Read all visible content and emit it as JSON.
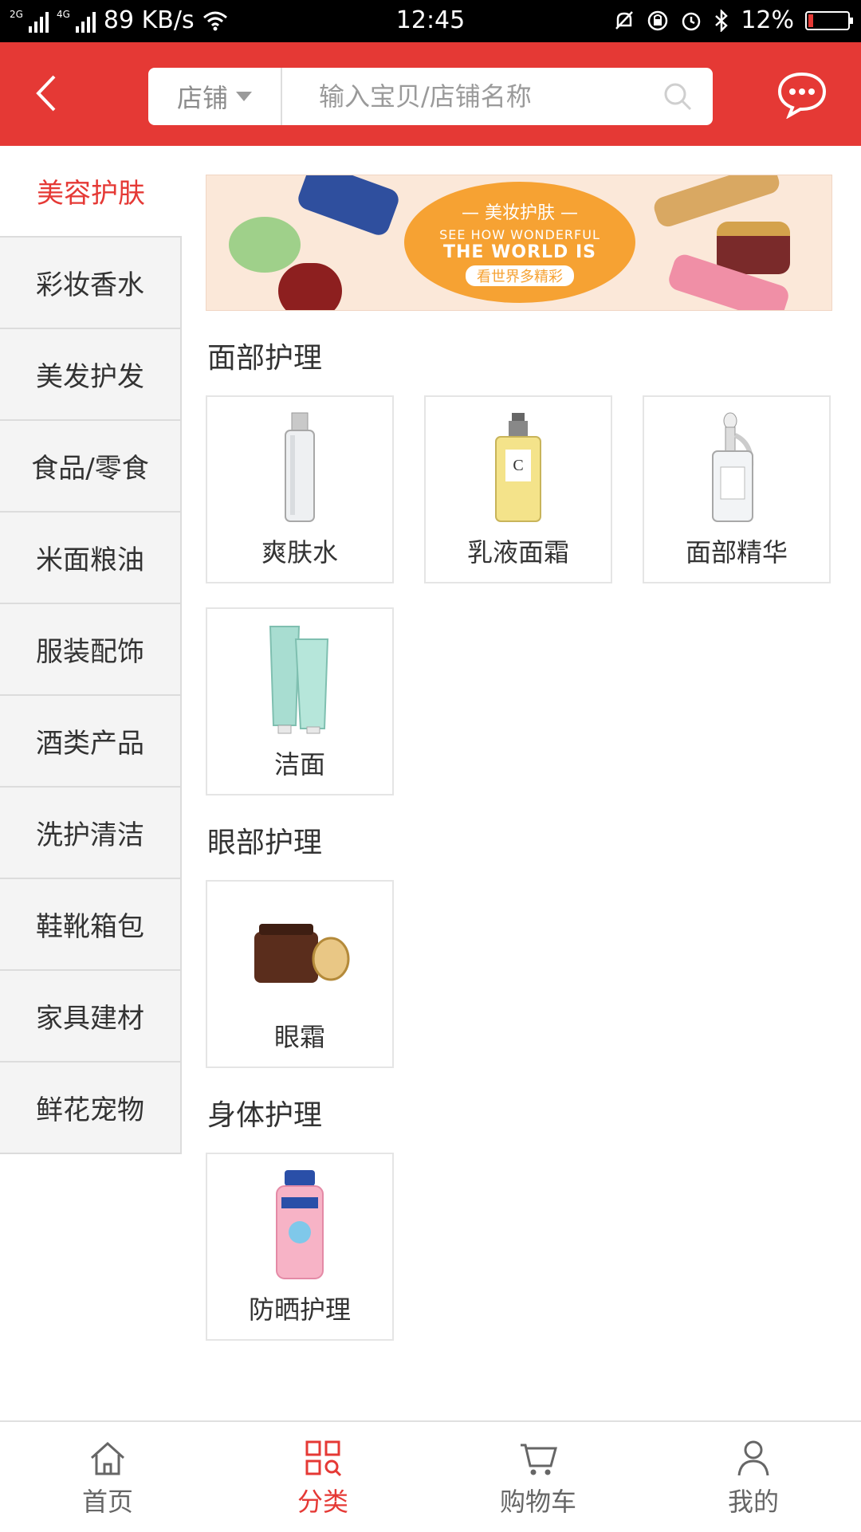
{
  "status_bar": {
    "network_2g": "2G",
    "network_4g": "4G",
    "speed": "89 KB/s",
    "time": "12:45",
    "battery": "12%",
    "battery_level": 0.12
  },
  "header": {
    "search_scope": "店铺",
    "search_placeholder": "输入宝贝/店铺名称"
  },
  "sidebar": {
    "items": [
      {
        "label": "美容护肤",
        "active": true
      },
      {
        "label": "彩妆香水"
      },
      {
        "label": "美发护发"
      },
      {
        "label": "食品/零食"
      },
      {
        "label": "米面粮油"
      },
      {
        "label": "服装配饰"
      },
      {
        "label": "酒类产品"
      },
      {
        "label": "洗护清洁"
      },
      {
        "label": "鞋靴箱包"
      },
      {
        "label": "家具建材"
      },
      {
        "label": "鲜花宠物"
      }
    ]
  },
  "banner": {
    "line1": "— 美妆护肤 —",
    "line2": "SEE HOW WONDERFUL",
    "line3": "THE WORLD IS",
    "line4": "看世界多精彩"
  },
  "sections": [
    {
      "title": "面部护理",
      "items": [
        {
          "name": "爽肤水",
          "icon": "toner-bottle-icon"
        },
        {
          "name": "乳液面霜",
          "icon": "lotion-bottle-icon"
        },
        {
          "name": "面部精华",
          "icon": "serum-dropper-icon"
        },
        {
          "name": "洁面",
          "icon": "cleanser-tubes-icon"
        }
      ]
    },
    {
      "title": "眼部护理",
      "items": [
        {
          "name": "眼霜",
          "icon": "eye-cream-jar-icon"
        }
      ]
    },
    {
      "title": "身体护理",
      "items": [
        {
          "name": "防晒护理",
          "icon": "sunscreen-bottle-icon"
        }
      ]
    }
  ],
  "tabbar": {
    "items": [
      {
        "label": "首页",
        "icon": "home-icon"
      },
      {
        "label": "分类",
        "icon": "category-icon",
        "active": true
      },
      {
        "label": "购物车",
        "icon": "cart-icon"
      },
      {
        "label": "我的",
        "icon": "user-icon"
      }
    ]
  },
  "colors": {
    "brand_red": "#e53935",
    "banner_orange": "#f6a233"
  }
}
